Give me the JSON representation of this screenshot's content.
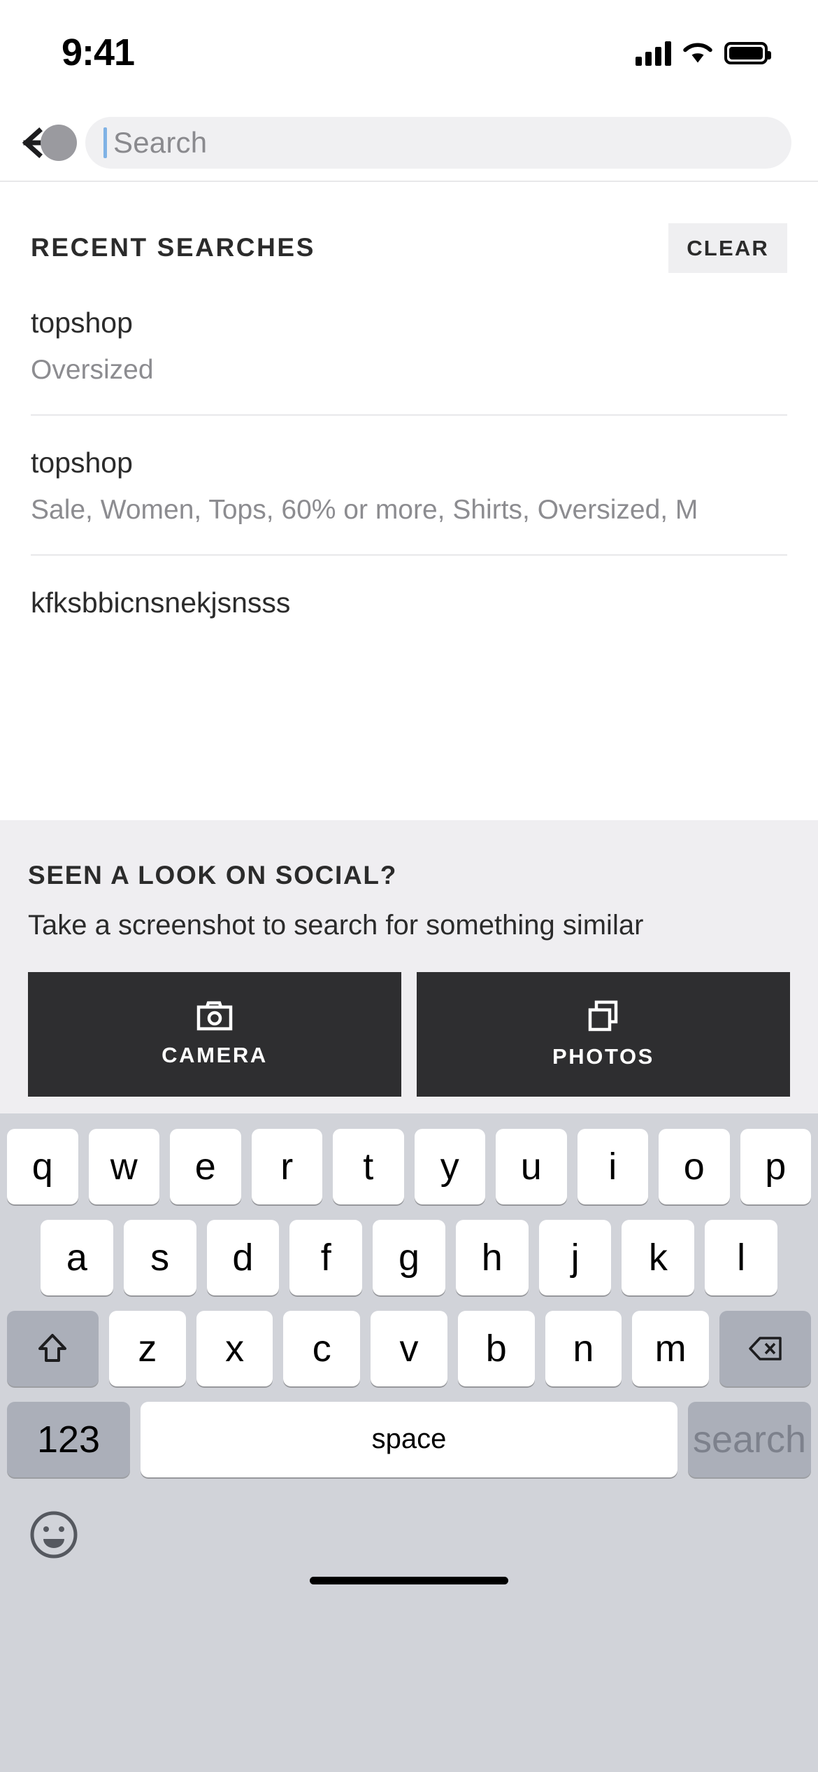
{
  "status_bar": {
    "time": "9:41",
    "signal_icon": "cellular-signal-icon",
    "wifi_icon": "wifi-icon",
    "battery_icon": "battery-icon"
  },
  "search_header": {
    "back_icon": "back-arrow-icon",
    "placeholder": "Search",
    "value": "",
    "touch_indicator": "touch-point-indicator"
  },
  "recent": {
    "title": "RECENT SEARCHES",
    "clear_label": "CLEAR",
    "items": [
      {
        "term": "topshop",
        "filters": "Oversized"
      },
      {
        "term": "topshop",
        "filters": "Sale, Women, Tops, 60% or more, Shirts, Oversized, M"
      },
      {
        "term": "kfksbbicnsnekjsnsss",
        "filters": ""
      }
    ]
  },
  "social": {
    "title": "SEEN A LOOK ON SOCIAL?",
    "subtitle": "Take a screenshot to search for something similar",
    "camera_label": "CAMERA",
    "camera_icon": "camera-icon",
    "photos_label": "PHOTOS",
    "photos_icon": "photos-stack-icon"
  },
  "keyboard": {
    "row1": [
      "q",
      "w",
      "e",
      "r",
      "t",
      "y",
      "u",
      "i",
      "o",
      "p"
    ],
    "row2": [
      "a",
      "s",
      "d",
      "f",
      "g",
      "h",
      "j",
      "k",
      "l"
    ],
    "row3": [
      "z",
      "x",
      "c",
      "v",
      "b",
      "n",
      "m"
    ],
    "shift_icon": "shift-key-icon",
    "backspace_icon": "backspace-key-icon",
    "numbers_label": "123",
    "space_label": "space",
    "search_label": "search",
    "emoji_icon": "emoji-key-icon"
  },
  "colors": {
    "button_dark": "#2e2e30",
    "panel_gray": "#efeef1",
    "keyboard_bg": "#d1d3d9",
    "caret_blue": "#7fb2e5",
    "muted_text": "#8c8c90"
  }
}
